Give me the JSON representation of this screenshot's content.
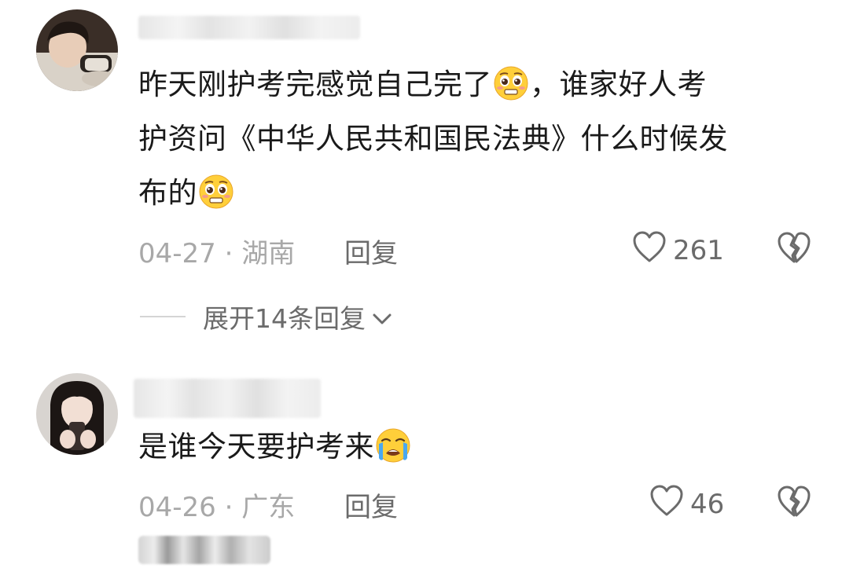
{
  "comments": [
    {
      "text_line1": "昨天刚护考完感觉自己完了",
      "text_line1b": "，谁家好人考",
      "text_line2": "护资问《中华人民共和国民法典》什么时候发",
      "text_line3": "布的",
      "date": "04-27",
      "location": "湖南",
      "separator": "·",
      "reply_label": "回复",
      "like_count": "261",
      "expand_label": "展开14条回复",
      "emoji_icon": "pleading-face-icon"
    },
    {
      "text": "是谁今天要护考来",
      "date": "04-26",
      "location": "广东",
      "separator": "·",
      "reply_label": "回复",
      "like_count": "46",
      "emoji_icon": "crying-face-icon"
    }
  ],
  "colors": {
    "text": "#1a1a1a",
    "meta": "#a8a8a8",
    "action": "#6b6b6b",
    "background": "#ffffff"
  }
}
